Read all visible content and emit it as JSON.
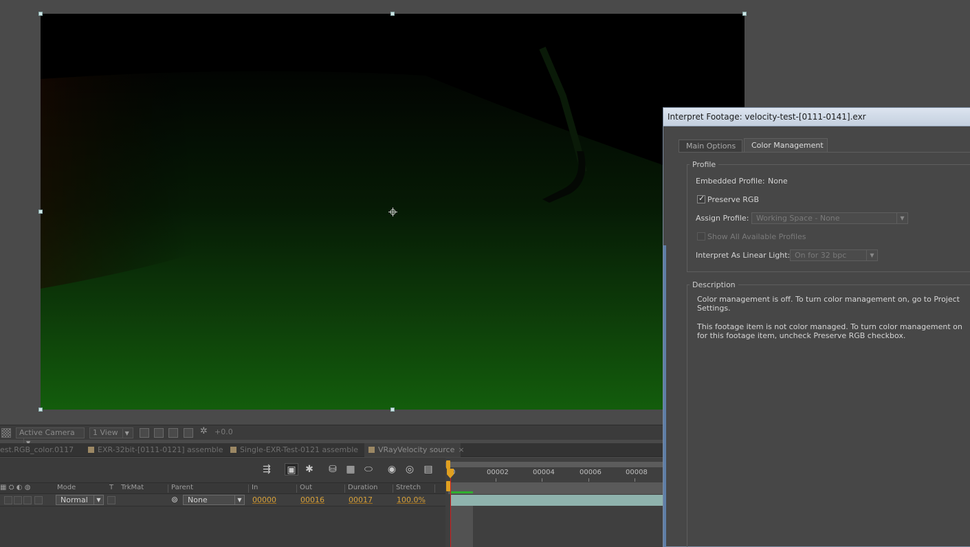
{
  "viewer": {
    "toolbar": {
      "camera": "Active Camera",
      "views": "1 View",
      "exposure": "+0.0"
    }
  },
  "timeline": {
    "tabs": [
      {
        "label": "est.RGB_color.0117"
      },
      {
        "label": "EXR-32bit-[0111-0121] assemble"
      },
      {
        "label": "Single-EXR-Test-0121 assemble"
      },
      {
        "label": "VRayVelocity source",
        "active": true,
        "close": "×"
      }
    ],
    "columns": {
      "mode": "Mode",
      "t": "T",
      "trkmat": "TrkMat",
      "parent": "Parent",
      "in": "In",
      "out": "Out",
      "duration": "Duration",
      "stretch": "Stretch"
    },
    "row": {
      "mode": "Normal",
      "parent": "None",
      "in": "00000",
      "out": "00016",
      "duration": "00017",
      "stretch": "100.0%"
    },
    "ruler": [
      "00002",
      "00004",
      "00006",
      "00008"
    ],
    "ruler_start": "0",
    "cti_frame": "0"
  },
  "dialog": {
    "title": "Interpret Footage: velocity-test-[0111-0141].exr",
    "tabs": [
      {
        "label": "Main Options",
        "active": false
      },
      {
        "label": "Color Management",
        "active": true
      }
    ],
    "profile_group": "Profile",
    "embedded_profile_label": "Embedded Profile:",
    "embedded_profile_value": "None",
    "preserve_rgb": {
      "label": "Preserve RGB",
      "checked": true
    },
    "assign_profile_label": "Assign Profile:",
    "assign_profile_value": "Working Space - None",
    "show_all_profiles": {
      "label": "Show All Available Profiles",
      "checked": false
    },
    "linear_light_label": "Interpret As Linear Light:",
    "linear_light_value": "On for 32 bpc",
    "description_group": "Description",
    "description_1": "Color management is off. To turn color management on, go to Project Settings.",
    "description_2": "This footage item is not color managed. To turn color management on for this footage item, uncheck Preserve RGB checkbox."
  },
  "colors": {
    "accent_orange": "#d8a13a",
    "layer_bar": "#8fb3ad",
    "cti": "#d02020"
  }
}
